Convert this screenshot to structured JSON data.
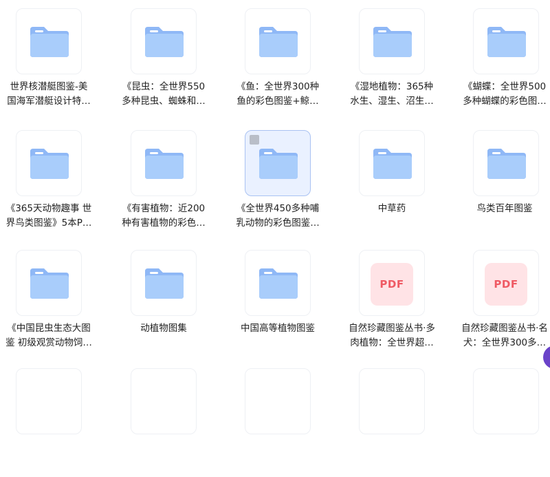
{
  "items": [
    {
      "type": "folder",
      "line1": "世界核潜艇图鉴-美",
      "line2": "国海军潜艇设计特…"
    },
    {
      "type": "folder",
      "line1": "《昆虫：全世界550",
      "line2": "多种昆虫、蜘蛛和…"
    },
    {
      "type": "folder",
      "line1": "《鱼：全世界300种",
      "line2": "鱼的彩色图鉴+鲸…"
    },
    {
      "type": "folder",
      "line1": "《湿地植物：365种",
      "line2": "水生、湿生、沼生…"
    },
    {
      "type": "folder",
      "line1": "《蝴蝶：全世界500",
      "line2": "多种蝴蝶的彩色图…"
    },
    {
      "type": "folder",
      "line1": "《365天动物趣事 世",
      "line2": "界鸟类图鉴》5本P…"
    },
    {
      "type": "folder",
      "line1": "《有害植物：近200",
      "line2": "种有害植物的彩色…"
    },
    {
      "type": "folder",
      "selected": true,
      "line1": "《全世界450多种哺",
      "line2": "乳动物的彩色图鉴…"
    },
    {
      "type": "folder",
      "line1": "中草药",
      "line2": ""
    },
    {
      "type": "folder",
      "line1": "鸟类百年图鉴",
      "line2": ""
    },
    {
      "type": "folder",
      "line1": "《中国昆虫生态大图",
      "line2": "鉴 初级观赏动物饲…"
    },
    {
      "type": "folder",
      "line1": "动植物图集",
      "line2": ""
    },
    {
      "type": "folder",
      "line1": "中国高等植物图鉴",
      "line2": ""
    },
    {
      "type": "pdf",
      "badge": "PDF",
      "line1": "自然珍藏图鉴丛书·多",
      "line2": "肉植物：全世界超…"
    },
    {
      "type": "pdf",
      "badge": "PDF",
      "line1": "自然珍藏图鉴丛书·名",
      "line2": "犬：全世界300多…"
    }
  ],
  "colors": {
    "folder_light": "#a9cdfb",
    "folder_dark": "#8fb8f6",
    "pdf_bg": "#ffe3e6",
    "pdf_text": "#ef5a64",
    "selected_bg": "#eaf1ff"
  }
}
